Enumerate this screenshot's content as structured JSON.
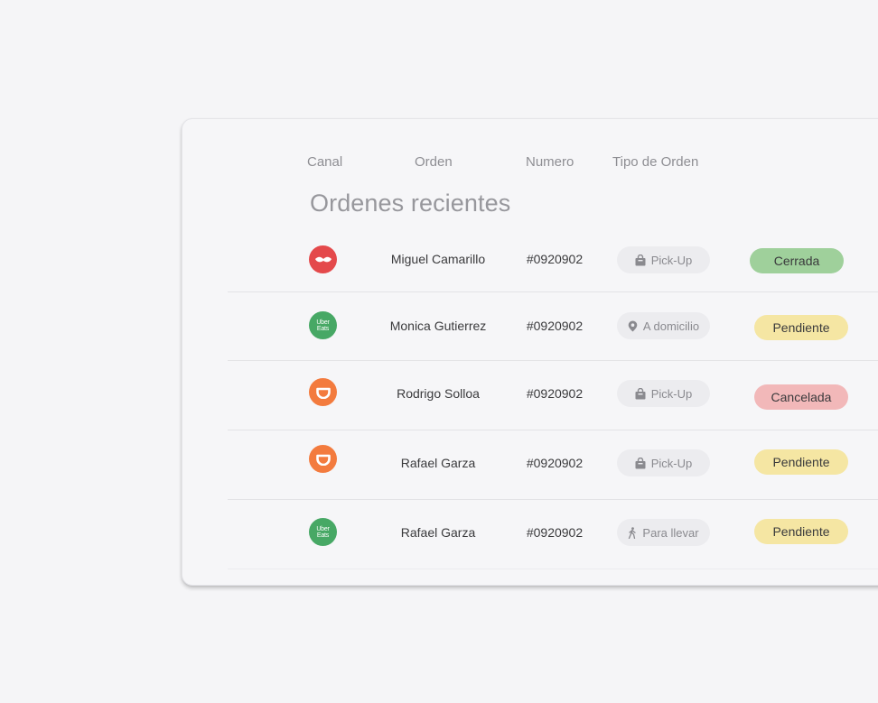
{
  "table": {
    "headers": {
      "canal": "Canal",
      "orden": "Orden",
      "numero": "Numero",
      "tipo": "Tipo de Orden"
    },
    "title": "Ordenes recientes",
    "rows": [
      {
        "channel": "rappi",
        "channel_icon": "rappi-logo-icon",
        "name": "Miguel Camarillo",
        "number": "#0920902",
        "type": "Pick-Up",
        "type_icon": "shopping-bag-icon",
        "status": "Cerrada",
        "status_color": "#9fd09b"
      },
      {
        "channel": "uber-eats",
        "channel_icon": "uber-eats-logo-icon",
        "channel_logo_text": "Uber Eats",
        "name": "Monica Gutierrez",
        "number": "#0920902",
        "type": "A domicilio",
        "type_icon": "location-pin-icon",
        "status": "Pendiente",
        "status_color": "#f5e6a3"
      },
      {
        "channel": "didi-food",
        "channel_icon": "didi-logo-icon",
        "name": "Rodrigo Solloa",
        "number": "#0920902",
        "type": "Pick-Up",
        "type_icon": "shopping-bag-icon",
        "status": "Cancelada",
        "status_color": "#f2b8b9"
      },
      {
        "channel": "didi-food",
        "channel_icon": "didi-logo-icon",
        "name": "Rafael Garza",
        "number": "#0920902",
        "type": "Pick-Up",
        "type_icon": "shopping-bag-icon",
        "status": "Pendiente",
        "status_color": "#f5e6a3"
      },
      {
        "channel": "uber-eats",
        "channel_icon": "uber-eats-logo-icon",
        "channel_logo_text": "Uber Eats",
        "name": "Rafael Garza",
        "number": "#0920902",
        "type": "Para llevar",
        "type_icon": "walking-person-icon",
        "status": "Pendiente",
        "status_color": "#f5e6a3"
      }
    ]
  }
}
